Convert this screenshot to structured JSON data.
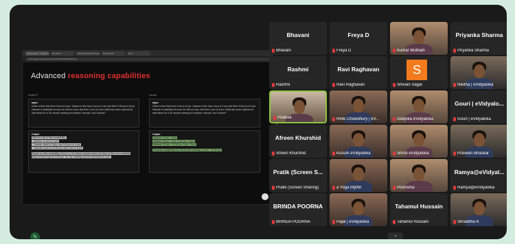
{
  "browser": {
    "tabs": [
      "Advanced R... Google Slides",
      "Gemini AI",
      "Exploring Gemini AI capabilities",
      "Prompt Lab",
      "New"
    ],
    "url": "docs.google.com/presentation/d/1rWX/edit#slide=id.p"
  },
  "slide": {
    "title_plain": "Advanced ",
    "title_highlight": "reasoning capabilities",
    "left_column": {
      "name": "ChatGPT",
      "input_label": "Input",
      "input_text": "Given a free time from 9 am to 5 pm: Joanne is free from noon to 2 pm and then 3:30 pm to 5 pm. Hannah is available at noon for half an hour, and then 4 pm to 6 pm. What are some options for start times for a 30 minute meeting for Andrew, Hannah, and Joanne?",
      "output_label": "Output",
      "output_lines": [
        "Here is a list of their availability:",
        "- Andrew: 11 am to 3 pm",
        "- Joanne: noon to 2 pm, and 3:30 pm to 5 pm",
        "- Hannah: noon to 12:30 pm, and 4 pm to 6 pm"
      ],
      "output_text": "Based on their availability, there is a 30-minute window where all three of them are available, which is from 4 pm to 4:30 pm. So, the meeting can be scheduled at 4 pm."
    },
    "right_column": {
      "name": "Gemini",
      "input_label": "Input",
      "input_text": "Given a free time from 9 am to 5 pm: Joanne is free from noon to 2 pm and then 3:30 pm to 5 pm. Hannah is available at noon for half an hour, and then 4 pm to 6 pm. What are some options for start times for a 30 minute meeting for Andrew, Hannah, and Joanne?",
      "output_label": "Output",
      "output_lines": [
        "Andrew: 11 am - 3 pm",
        "Joanne: 12 pm - 2 pm, 3:30 pm - 5 pm",
        "Hannah: 12 pm - 12:30 pm, 4 pm - 6 pm"
      ],
      "output_text": "Common availability for a 30-minute meeting: 12 pm - 12:30 pm"
    }
  },
  "participants": [
    {
      "big": "Bhavani",
      "label": "Bhavani",
      "video": false
    },
    {
      "big": "Freya D",
      "label": "Freya D",
      "video": false
    },
    {
      "big": "",
      "label": "Kumar Muthiah",
      "video": true
    },
    {
      "big": "Priyanka Sharma",
      "label": "Priyanka Sharma",
      "video": false
    },
    {
      "big": "Rashmi",
      "label": "Rashmi",
      "video": false
    },
    {
      "big": "Ravi Raghavan",
      "label": "Ravi Raghavan",
      "video": false
    },
    {
      "big": "",
      "label": "Shivani Sagar",
      "video": false,
      "avatar": "S"
    },
    {
      "big": "",
      "label": "Nikitha | eVidyaloka",
      "video": true
    },
    {
      "big": "",
      "label": "Prateek",
      "video": true,
      "speaking": true
    },
    {
      "big": "",
      "label": "Rinki Chowdhury | eV...",
      "video": true
    },
    {
      "big": "",
      "label": "Deepika eVidyaloka",
      "video": true
    },
    {
      "big": "Gouri | eVidyalo...",
      "label": "Gouri | eVidyaloka",
      "video": false
    },
    {
      "big": "Afreen Khurshid",
      "label": "Afreen Khurshid",
      "video": false
    },
    {
      "big": "",
      "label": "Kusum eVidyaloka",
      "video": true
    },
    {
      "big": "",
      "label": "Shruti eVidyaloka",
      "video": true
    },
    {
      "big": "",
      "label": "Praveen Bhaskar",
      "video": true
    },
    {
      "big": "Pratik (Screen S...",
      "label": "Pratik (Screen Sharing)",
      "video": false
    },
    {
      "big": "",
      "label": "a Yoga Mythri",
      "video": true
    },
    {
      "big": "",
      "label": "Poornima",
      "video": true
    },
    {
      "big": "Ramya@eVidyal...",
      "label": "Ramya@eVidyaloka",
      "video": false
    },
    {
      "big": "BRINDA POORNA",
      "label": "BRINDA POORNA",
      "video": false
    },
    {
      "big": "",
      "label": "Pajal | eVidyaloka",
      "video": true
    },
    {
      "big": "Tahamul Hussain",
      "label": "Tahamul Hussain",
      "video": false
    },
    {
      "big": "",
      "label": "Shraddha K",
      "video": true
    }
  ],
  "colors": {
    "background": "#d4ece0",
    "tile": "#262626",
    "accent_red": "#e02f2f",
    "speaking_border": "#8cc63f",
    "avatar_orange": "#f17b1d"
  }
}
